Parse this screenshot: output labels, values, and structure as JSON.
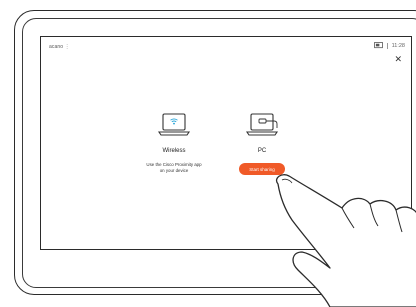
{
  "status": {
    "left_text": "acano ⋮",
    "time": "11:28"
  },
  "options": {
    "wireless": {
      "label": "Wireless",
      "description_line1": "Use the Cisco Proximity app",
      "description_line2": "on your device",
      "icon": "laptop-wireless-icon"
    },
    "pc": {
      "label": "PC",
      "button_label": "Start sharing",
      "icon": "laptop-cable-icon"
    }
  },
  "colors": {
    "accent": "#f05a28"
  }
}
